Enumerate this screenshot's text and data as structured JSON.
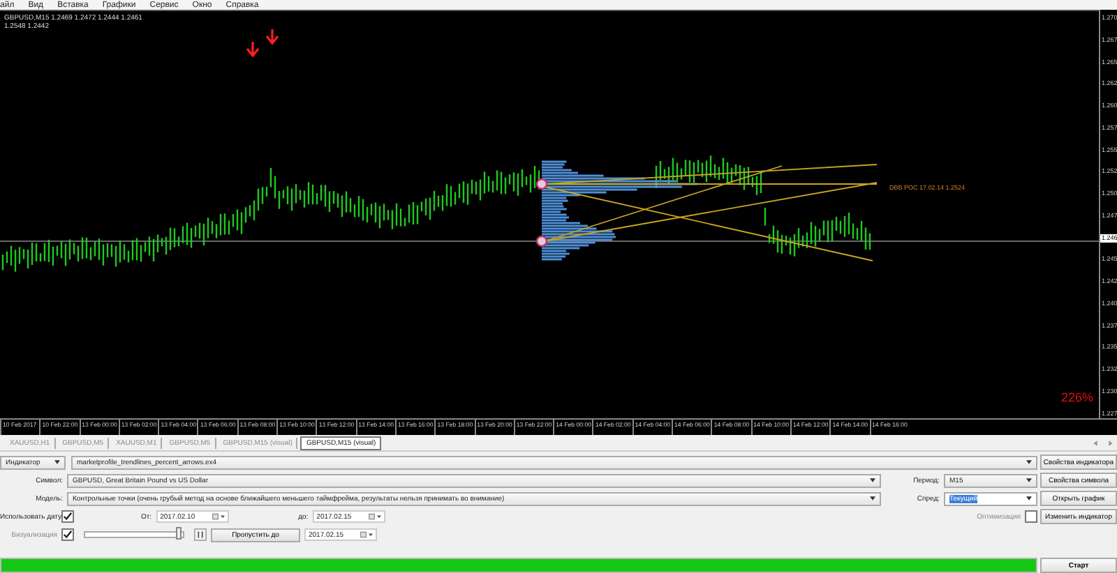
{
  "menu": [
    "айл",
    "Вид",
    "Вставка",
    "Графики",
    "Сервис",
    "Окно",
    "Справка"
  ],
  "chart": {
    "info_lines": [
      "GBPUSD,M15  1.2469 1.2472 1.2444 1.2461",
      "1.2548 1.2442"
    ],
    "poc_label": "DBB POC 17.02.14 1.2524",
    "percent": "226%",
    "price_labels": [
      {
        "text": "1.270",
        "selected": false
      },
      {
        "text": "1.267",
        "selected": false
      },
      {
        "text": "1.265",
        "selected": false
      },
      {
        "text": "1.262",
        "selected": false
      },
      {
        "text": "1.260",
        "selected": false
      },
      {
        "text": "1.257",
        "selected": false
      },
      {
        "text": "1.255",
        "selected": false
      },
      {
        "text": "1.252",
        "selected": false
      },
      {
        "text": "1.250",
        "selected": false
      },
      {
        "text": "1.247",
        "selected": false
      },
      {
        "text": "1.246",
        "selected": true
      },
      {
        "text": "1.245",
        "selected": false
      },
      {
        "text": "1.242",
        "selected": false
      },
      {
        "text": "1.240",
        "selected": false
      },
      {
        "text": "1.237",
        "selected": false
      },
      {
        "text": "1.235",
        "selected": false
      },
      {
        "text": "1.232",
        "selected": false
      },
      {
        "text": "1.230",
        "selected": false
      },
      {
        "text": "1.227",
        "selected": false
      }
    ],
    "time_labels": [
      "10 Feb 2017",
      "10 Feb 22:00",
      "13 Feb 00:00",
      "13 Feb 02:00",
      "13 Feb 04:00",
      "13 Feb 06:00",
      "13 Feb 08:00",
      "13 Feb 10:00",
      "13 Feb 12:00",
      "13 Feb 14:00",
      "13 Feb 16:00",
      "13 Feb 18:00",
      "13 Feb 20:00",
      "13 Feb 22:00",
      "14 Feb 00:00",
      "14 Feb 02:00",
      "14 Feb 04:00",
      "14 Feb 06:00",
      "14 Feb 08:00",
      "14 Feb 10:00",
      "14 Feb 12:00",
      "14 Feb 14:00",
      "14 Feb 16:00"
    ]
  },
  "tabs": [
    {
      "label": "XAUUSD,H1",
      "selected": false
    },
    {
      "label": "GBPUSD,M5",
      "selected": false
    },
    {
      "label": "XAUUSD,M1",
      "selected": false
    },
    {
      "label": "GBPUSD,M5",
      "selected": false
    },
    {
      "label": "GBPUSD,M15 (visual)",
      "selected": false
    },
    {
      "label": "GBPUSD,M15 (visual)",
      "selected": true
    }
  ],
  "tester": {
    "type_select": "Индикатор",
    "file": "marketprofile_trendlines_percent_arrows.ex4",
    "symbol_label": "Символ:",
    "symbol": "GBPUSD, Great Britain Pound vs US Dollar",
    "period_label": "Период:",
    "period": "M15",
    "model_label": "Модель:",
    "model": "Контрольные точки (очень грубый метод на основе ближайшего меньшего таймфрейма, результаты нельзя принимать во внимание)",
    "spread_label": "Спред:",
    "spread": "Текущий",
    "use_date": {
      "label": "Использовать дату",
      "checked": true
    },
    "from_label": "От:",
    "from": "2017.02.10",
    "to_label": "до:",
    "to": "2017.02.15",
    "optimization": {
      "label": "Оптимизация",
      "checked": false
    },
    "visualization": {
      "label": "Визуализация",
      "checked": true
    },
    "speed": {
      "level": 0.97
    },
    "skip_button": "Пропустить до",
    "skip_date": "2017.02.15",
    "progress": {
      "level": 1
    },
    "buttons": [
      "Свойства индикатора",
      "Свойства символа",
      "Открыть график",
      "Изменить индикатор"
    ],
    "start_button": "Старт"
  }
}
